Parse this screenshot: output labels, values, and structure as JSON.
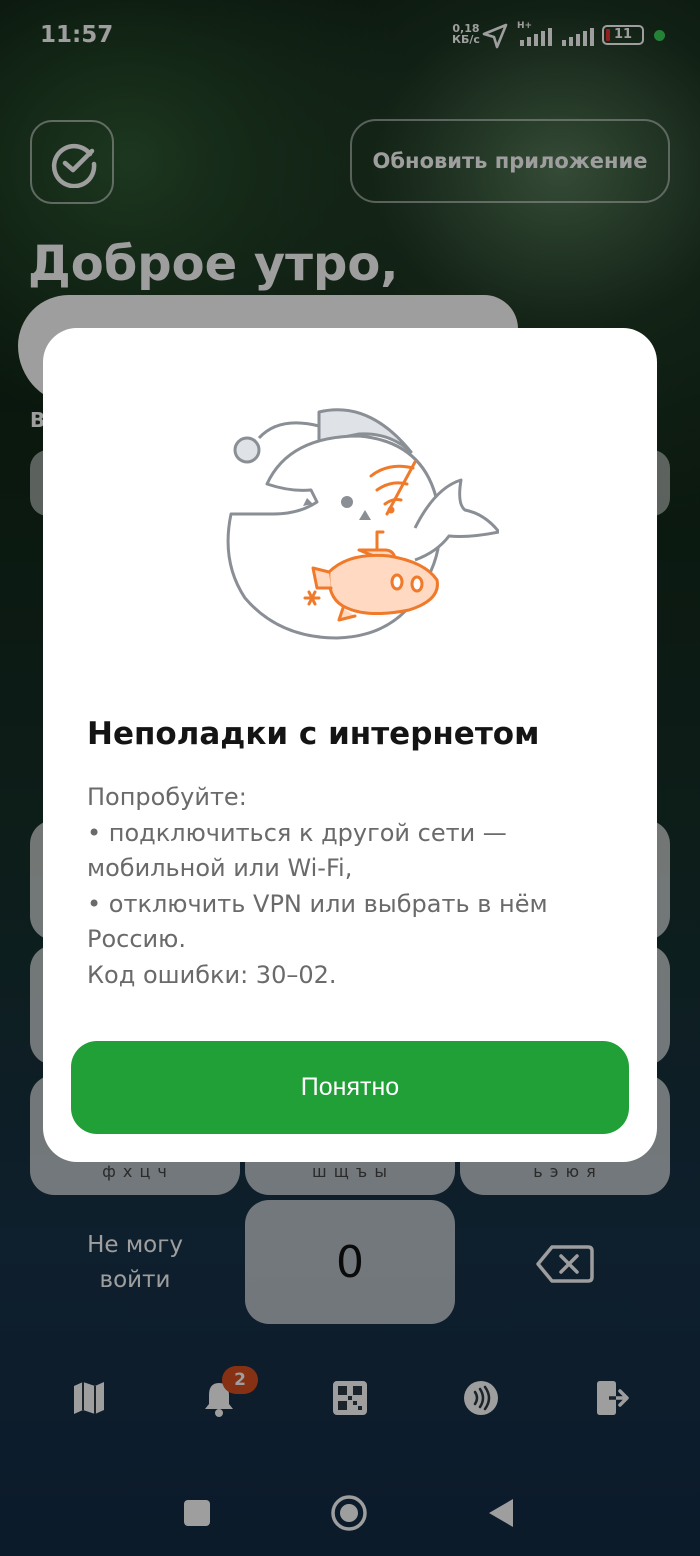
{
  "status_bar": {
    "time": "11:57",
    "net_speed_value": "0,18",
    "net_speed_unit": "КБ/с",
    "network_type": "H+",
    "battery_level": "11"
  },
  "header": {
    "update_button_label": "Обновить приложение",
    "greeting": "Доброе утро,"
  },
  "background": {
    "partial_label": "В"
  },
  "keypad": {
    "row3_letters": [
      "ф х ц ч",
      "ш щ ъ ы",
      "ь э ю я"
    ],
    "zero_key": "0",
    "cant_login_label": [
      "Не могу",
      "войти"
    ]
  },
  "bottom_nav": {
    "items": [
      "map-icon",
      "bell-icon",
      "qr-code-icon",
      "contactless-icon",
      "logout-icon"
    ],
    "notification_count": "2"
  },
  "dialog": {
    "title": "Неполадки с интернетом",
    "body_lines": [
      "Попробуйте:",
      " • подключиться к другой сети —",
      "мобильной или Wi-Fi,",
      " • отключить VPN или выбрать в нём",
      "Россию.",
      "Код ошибки: 30–02."
    ],
    "ok_button_label": "Понятно"
  },
  "colors": {
    "accent_green": "#21a038",
    "illustration_orange": "#f07a2a",
    "badge_orange": "#d9501f"
  }
}
